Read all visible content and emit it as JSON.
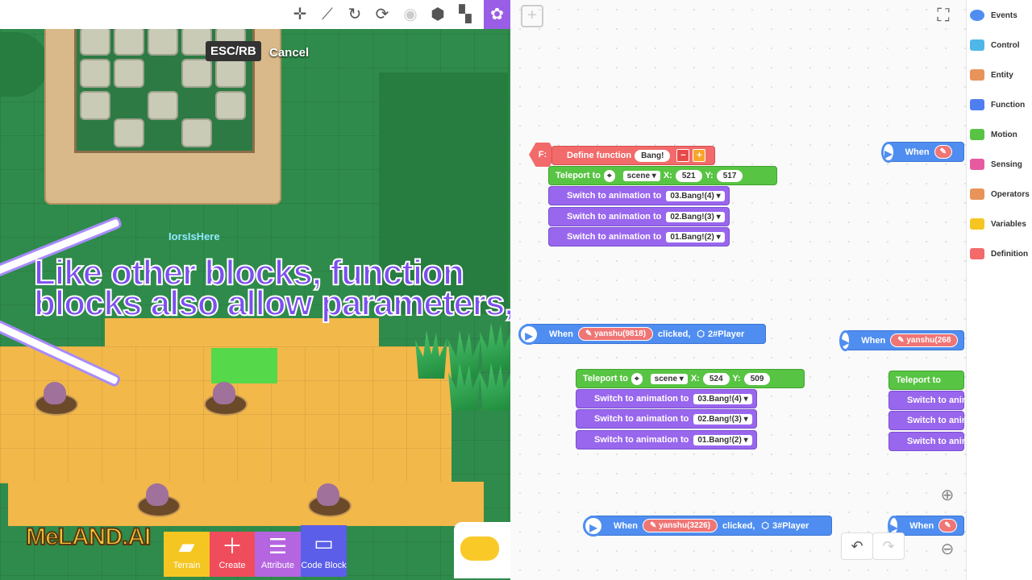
{
  "top_toolbar": {
    "icons": [
      "plus-move-icon",
      "wand-icon",
      "rotate-icon",
      "refresh-icon",
      "stop-icon",
      "cube-icon",
      "map-icon",
      "palette-icon"
    ]
  },
  "game": {
    "esc_label": "ESC/RB",
    "cancel_label": "Cancel",
    "player_name": "IorsIsHere",
    "subtitle_line1": "Like other blocks, function",
    "subtitle_line2": "blocks also allow parameters,",
    "logo_text": "MeLAND.AI"
  },
  "bottom_toolbar": {
    "terrain": "Terrain",
    "create": "Create",
    "attribute": "Attribute",
    "code_block": "Code Block"
  },
  "editor": {
    "define": {
      "label": "Define function",
      "name": "Bang!"
    },
    "teleport1": {
      "label": "Teleport to",
      "scene": "scene",
      "x_label": "X:",
      "x": "521",
      "y_label": "Y:",
      "y": "517"
    },
    "switches1": [
      {
        "label": "Switch to animation to",
        "value": "03.Bang!(4)"
      },
      {
        "label": "Switch to animation to",
        "value": "02.Bang!(3)"
      },
      {
        "label": "Switch to animation to",
        "value": "01.Bang!(2)"
      }
    ],
    "event1": {
      "when": "When",
      "target": "yanshu(9818)",
      "clicked": "clicked,",
      "player": "2#Player"
    },
    "teleport2": {
      "label": "Teleport to",
      "scene": "scene",
      "x_label": "X:",
      "x": "524",
      "y_label": "Y:",
      "y": "509"
    },
    "switches2": [
      {
        "label": "Switch to animation to",
        "value": "03.Bang!(4)"
      },
      {
        "label": "Switch to animation to",
        "value": "02.Bang!(3)"
      },
      {
        "label": "Switch to animation to",
        "value": "01.Bang!(2)"
      }
    ],
    "event2": {
      "when": "When",
      "target": "yanshu(3226)",
      "clicked": "clicked,",
      "player": "3#Player"
    },
    "right_when1": "When",
    "right_event_when": "When",
    "right_event_target": "yanshu(268",
    "right_teleport": "Teleport to",
    "right_switches": [
      "Switch to anim",
      "Switch to anim",
      "Switch to anim"
    ],
    "right_when2": "When"
  },
  "categories": [
    {
      "label": "Events",
      "color": "#4f8ef0"
    },
    {
      "label": "Control",
      "color": "#4fb7e8"
    },
    {
      "label": "Entity",
      "color": "#e8935a"
    },
    {
      "label": "Function",
      "color": "#4f7ef0"
    },
    {
      "label": "Motion",
      "color": "#58c443"
    },
    {
      "label": "Sensing",
      "color": "#e85aa0"
    },
    {
      "label": "Operators",
      "color": "#e8935a"
    },
    {
      "label": "Variables",
      "color": "#f5c521"
    },
    {
      "label": "Definition",
      "color": "#f26a6a"
    }
  ]
}
